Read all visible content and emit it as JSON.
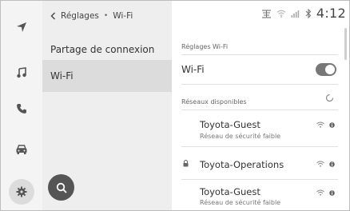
{
  "breadcrumb": {
    "parent": "Réglages",
    "separator": "•",
    "current": "Wi-Fi"
  },
  "menu": {
    "items": [
      {
        "label": "Partage de connexion",
        "selected": false
      },
      {
        "label": "Wi-Fi",
        "selected": true
      }
    ]
  },
  "status_bar": {
    "time": "4:12"
  },
  "settings": {
    "section_title": "Réglages Wi-Fi",
    "wifi_label": "Wi-Fi",
    "wifi_enabled": true,
    "networks_title": "Réseaux disponibles",
    "networks": [
      {
        "name": "Toyota-Guest",
        "subtitle": "Réseau de sécurité faible",
        "locked": false
      },
      {
        "name": "Toyota-Operations",
        "subtitle": "",
        "locked": true
      },
      {
        "name": "Toyota-Guest",
        "subtitle": "Réseau de sécurité faible",
        "locked": false
      }
    ]
  },
  "rail": {
    "icons": [
      "navigation-icon",
      "music-icon",
      "phone-icon",
      "car-icon",
      "settings-gear-icon"
    ],
    "active": "settings-gear-icon"
  },
  "colors": {
    "toggle_on": "#777777",
    "selected_row": "#dcdcdc",
    "pane_bg": "#eeeeee"
  }
}
